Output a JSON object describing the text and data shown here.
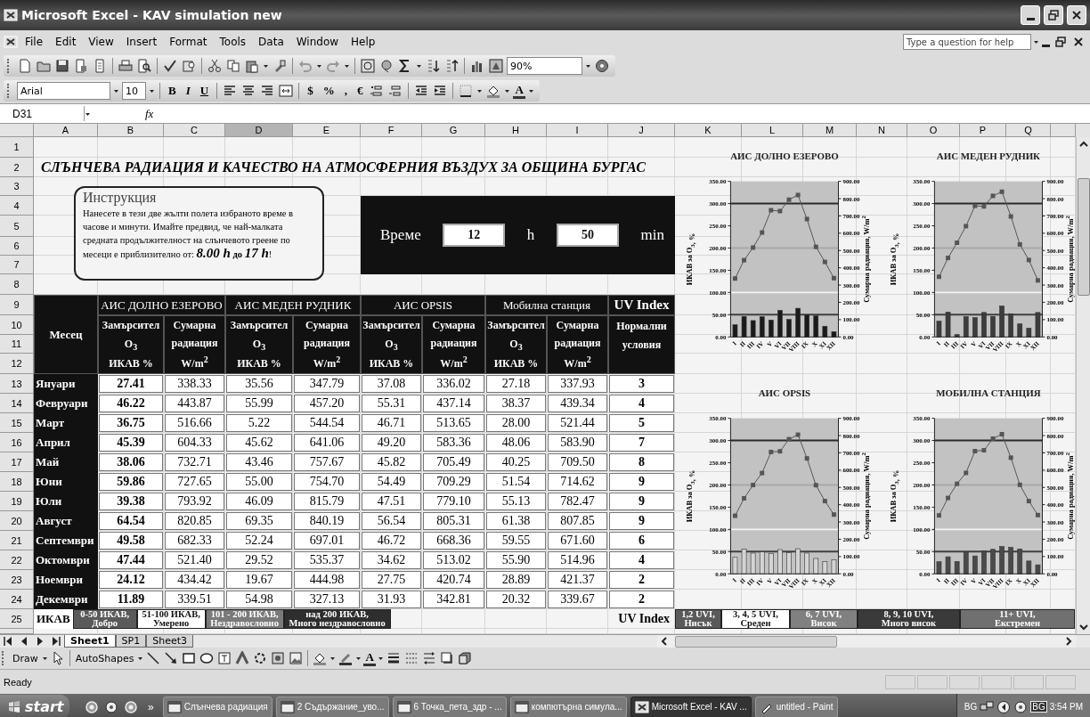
{
  "window": {
    "title": "Microsoft Excel - KAV simulation new"
  },
  "menu": {
    "items": [
      "File",
      "Edit",
      "View",
      "Insert",
      "Format",
      "Tools",
      "Data",
      "Window",
      "Help"
    ],
    "help_placeholder": "Type a question for help"
  },
  "standard_toolbar": {
    "zoom": "90%"
  },
  "formatting_toolbar": {
    "font": "Arial",
    "size": "10",
    "style_buttons": [
      "B",
      "I",
      "U"
    ],
    "number_buttons": [
      "$",
      "%",
      ",",
      "€"
    ],
    "font_color": "A"
  },
  "formula_bar": {
    "name_box": "D31",
    "function_label": "fx"
  },
  "columns": [
    {
      "label": "A",
      "selected": false
    },
    {
      "label": "B",
      "selected": false
    },
    {
      "label": "C",
      "selected": false
    },
    {
      "label": "D",
      "selected": true
    },
    {
      "label": "E",
      "selected": false
    },
    {
      "label": "F",
      "selected": false
    },
    {
      "label": "G",
      "selected": false
    },
    {
      "label": "H",
      "selected": false
    },
    {
      "label": "I",
      "selected": false
    },
    {
      "label": "J",
      "selected": false
    },
    {
      "label": "K",
      "selected": false
    },
    {
      "label": "L",
      "selected": false
    },
    {
      "label": "M",
      "selected": false
    },
    {
      "label": "N",
      "selected": false
    },
    {
      "label": "O",
      "selected": false
    },
    {
      "label": "P",
      "selected": false
    },
    {
      "label": "Q",
      "selected": false
    }
  ],
  "row_numbers": [
    "1",
    "2",
    "3",
    "4",
    "5",
    "6",
    "7",
    "8",
    "9",
    "10",
    "11",
    "12",
    "13",
    "14",
    "15",
    "16",
    "17",
    "18",
    "19",
    "20",
    "21",
    "22",
    "23",
    "24",
    "25"
  ],
  "sheet": {
    "title": "СЛЪНЧЕВА РАДИАЦИЯ И КАЧЕСТВО НА АТМОСФЕРНИЯ ВЪЗДУХ ЗА ОБЩИНА БУРГАС",
    "instruction": {
      "heading": "Инструкция",
      "text": "Нанесете в тези две жълти полета избраното време в часове и минути. Имайте предвид, че най-малката средната продължителност на слънчевото греене по месеци е приблизително от: *8.00 h* **до** *17 h*!"
    },
    "time": {
      "label": "Време",
      "hours": "12",
      "hours_unit": "h",
      "minutes": "50",
      "minutes_unit": "min"
    },
    "table": {
      "month_header": "Месец",
      "stations": [
        {
          "name": "АИС ДОЛНО ЕЗЕРОВО",
          "columns": [
            [
              "Замърсител",
              "O$_{3}$",
              "ИКАВ %"
            ],
            [
              "Сумарна",
              "радиация",
              "W/m$^{2}$"
            ]
          ]
        },
        {
          "name": "АИС МЕДЕН РУДНИК",
          "columns": [
            [
              "Замърсител",
              "O$_{3}$",
              "ИКАВ %"
            ],
            [
              "Сумарна",
              "радиация",
              "W/m$^{2}$"
            ]
          ]
        },
        {
          "name": "АИС OPSIS",
          "columns": [
            [
              "Замърсител",
              "O$_{3}$",
              "ИКАВ %"
            ],
            [
              "Сумарна",
              "радиация",
              "W/m$^{2}$"
            ]
          ]
        },
        {
          "name": "Мобилна станция",
          "columns": [
            [
              "Замърсител",
              "O$_{3}$",
              "ИКАВ %"
            ],
            [
              "Сумарна",
              "радиация",
              "W/m$^{2}$"
            ]
          ]
        }
      ],
      "uv_header": "UV Index",
      "uv_subheader": [
        "Нормални",
        "условия"
      ],
      "rows": [
        {
          "month": "Януари",
          "values": [
            "27.41",
            "338.33",
            "35.56",
            "347.79",
            "37.08",
            "336.02",
            "27.18",
            "337.93",
            "3"
          ]
        },
        {
          "month": "Февруари",
          "values": [
            "46.22",
            "443.87",
            "55.99",
            "457.20",
            "55.31",
            "437.14",
            "38.37",
            "439.34",
            "4"
          ]
        },
        {
          "month": "Март",
          "values": [
            "36.75",
            "516.66",
            "5.22",
            "544.54",
            "46.71",
            "513.65",
            "28.00",
            "521.44",
            "5"
          ]
        },
        {
          "month": "Април",
          "values": [
            "45.39",
            "604.33",
            "45.62",
            "641.06",
            "49.20",
            "583.36",
            "48.06",
            "583.90",
            "7"
          ]
        },
        {
          "month": "Май",
          "values": [
            "38.06",
            "732.71",
            "43.46",
            "757.67",
            "45.82",
            "705.49",
            "40.25",
            "709.50",
            "8"
          ]
        },
        {
          "month": "Юни",
          "values": [
            "59.86",
            "727.65",
            "55.00",
            "754.70",
            "54.49",
            "709.29",
            "51.54",
            "714.62",
            "9"
          ]
        },
        {
          "month": "Юли",
          "values": [
            "39.38",
            "793.92",
            "46.09",
            "815.79",
            "47.51",
            "779.10",
            "55.13",
            "782.47",
            "9"
          ]
        },
        {
          "month": "Август",
          "values": [
            "64.54",
            "820.85",
            "69.35",
            "840.19",
            "56.54",
            "805.31",
            "61.38",
            "807.85",
            "9"
          ]
        },
        {
          "month": "Септември",
          "values": [
            "49.58",
            "682.33",
            "52.24",
            "697.01",
            "46.72",
            "668.36",
            "59.55",
            "671.60",
            "6"
          ]
        },
        {
          "month": "Октомври",
          "values": [
            "47.44",
            "521.40",
            "29.52",
            "535.37",
            "34.62",
            "513.02",
            "55.90",
            "514.96",
            "4"
          ]
        },
        {
          "month": "Ноември",
          "values": [
            "24.12",
            "434.42",
            "19.67",
            "444.98",
            "27.75",
            "420.74",
            "28.89",
            "421.37",
            "2"
          ]
        },
        {
          "month": "Декември",
          "values": [
            "11.89",
            "339.51",
            "54.98",
            "327.13",
            "31.93",
            "342.81",
            "20.32",
            "339.67",
            "2"
          ]
        }
      ]
    },
    "ikav_legend": {
      "label": "ИКАВ",
      "items": [
        {
          "lines": [
            "0-50 ИКАВ,",
            "Добро"
          ],
          "color": "#5a5a5a"
        },
        {
          "lines": [
            "51-100 ИКАВ,",
            "Умерено"
          ],
          "color": "#ffffff"
        },
        {
          "lines": [
            "101 - 200 ИКАВ,",
            "Нездравословно"
          ],
          "color": "#7a7a7a"
        },
        {
          "lines": [
            "над 200 ИКАВ,",
            "Много нездравословно"
          ],
          "color": "#2e2e2e"
        }
      ]
    },
    "uv_legend": {
      "label": "UV Index",
      "items": [
        {
          "lines": [
            "1,2 UVI,",
            "Нисък"
          ],
          "color": "#5a5a5a"
        },
        {
          "lines": [
            "3, 4, 5 UVI,",
            "Среден"
          ],
          "color": "#ffffff"
        },
        {
          "lines": [
            "6, 7 UVI,",
            "Висок"
          ],
          "color": "#808080"
        },
        {
          "lines": [
            "8, 9, 10 UVI,",
            "Много висок"
          ],
          "color": "#3a3a3a"
        },
        {
          "lines": [
            "11+ UVI,",
            "Екстремен"
          ],
          "color": "#707070"
        }
      ]
    },
    "charts": [
      {
        "chart_data": {
          "type": "bar",
          "title": "АИС ДОЛНО ЕЗЕРОВО",
          "ylabel": "ИКАВ за O$_{3}$, %",
          "categories": [
            "I",
            "II",
            "III",
            "IV",
            "V",
            "VI",
            "VII",
            "VIII",
            "IX",
            "X",
            "XI",
            "XII"
          ],
          "ylim": [
            0,
            350
          ],
          "series": [
            {
              "color": "#1a1a1a",
              "values": [
                27.4,
                46.2,
                36.8,
                45.4,
                38.1,
                59.9,
                39.4,
                64.5,
                49.6,
                47.4,
                24.1,
                11.9
              ]
            }
          ],
          "yticks": [
            {
              "value": 0,
              "label": "0.00"
            },
            {
              "value": 50,
              "label": "50.00"
            },
            {
              "value": 100,
              "label": "100.00"
            },
            {
              "value": 150,
              "label": "150.00"
            },
            {
              "value": 200,
              "label": "200.00"
            },
            {
              "value": 250,
              "label": "250.00"
            },
            {
              "value": 300,
              "label": "300.00"
            },
            {
              "value": 350,
              "label": "350.00"
            }
          ],
          "ref_lines": [
            {
              "axis": "y",
              "value": 50,
              "color": "#404040"
            },
            {
              "axis": "y",
              "value": 100,
              "color": "#f4f4f4"
            },
            {
              "axis": "y",
              "value": 200,
              "color": "#a8a8a8"
            },
            {
              "axis": "y",
              "value": 300,
              "color": "#2a2a2a"
            }
          ]
        },
        "radiation_overlay": {
          "chart_data": {
            "type": "line",
            "ylabel": "Сумарна радиация, W/m$^{2}$",
            "categories": [
              null,
              null,
              null,
              null,
              null,
              null,
              null,
              null,
              null,
              null,
              null,
              null
            ],
            "ylim": [
              0,
              900
            ],
            "series": [
              {
                "color": "#555555",
                "marker": "square",
                "values": [
                  338,
                  444,
                  517,
                  604,
                  733,
                  728,
                  794,
                  821,
                  682,
                  521,
                  434,
                  340
                ]
              }
            ],
            "yticks": [
              {
                "value": 0,
                "label": "0.00"
              },
              {
                "value": 100,
                "label": "100.00"
              },
              {
                "value": 200,
                "label": "200.00"
              },
              {
                "value": 300,
                "label": "300.00"
              },
              {
                "value": 400,
                "label": "400.00"
              },
              {
                "value": 500,
                "label": "500.00"
              },
              {
                "value": 600,
                "label": "600.00"
              },
              {
                "value": 700,
                "label": "700.00"
              },
              {
                "value": 800,
                "label": "800.00"
              },
              {
                "value": 900,
                "label": "900.00"
              }
            ]
          }
        }
      },
      {
        "chart_data": {
          "type": "bar",
          "title": "АИС МЕДЕН РУДНИК",
          "ylabel": "ИКАВ за O$_{3}$, %",
          "categories": [
            "I",
            "II",
            "III",
            "IV",
            "V",
            "VI",
            "VII",
            "VIII",
            "IX",
            "X",
            "XI",
            "XII"
          ],
          "ylim": [
            0,
            350
          ],
          "series": [
            {
              "color": "#3c3c3c",
              "values": [
                35.6,
                56.0,
                5.2,
                45.6,
                43.5,
                55.0,
                46.1,
                69.4,
                52.2,
                29.5,
                19.7,
                55.0
              ]
            }
          ],
          "yticks": [
            {
              "value": 0,
              "label": "0.00"
            },
            {
              "value": 50,
              "label": "50.00"
            },
            {
              "value": 100,
              "label": "100.00"
            },
            {
              "value": 150,
              "label": "150.00"
            },
            {
              "value": 200,
              "label": "200.00"
            },
            {
              "value": 250,
              "label": "250.00"
            },
            {
              "value": 300,
              "label": "300.00"
            },
            {
              "value": 350,
              "label": "350.00"
            }
          ],
          "ref_lines": [
            {
              "axis": "y",
              "value": 50,
              "color": "#404040"
            },
            {
              "axis": "y",
              "value": 100,
              "color": "#f4f4f4"
            },
            {
              "axis": "y",
              "value": 200,
              "color": "#a8a8a8"
            },
            {
              "axis": "y",
              "value": 300,
              "color": "#2a2a2a"
            }
          ]
        },
        "radiation_overlay": {
          "chart_data": {
            "type": "line",
            "ylabel": "Сумарна радиация, W/m$^{2}$",
            "categories": [
              null,
              null,
              null,
              null,
              null,
              null,
              null,
              null,
              null,
              null,
              null,
              null
            ],
            "ylim": [
              0,
              900
            ],
            "series": [
              {
                "color": "#555555",
                "marker": "square",
                "values": [
                  348,
                  457,
                  545,
                  641,
                  758,
                  755,
                  816,
                  840,
                  697,
                  535,
                  445,
                  327
                ]
              }
            ],
            "yticks": [
              {
                "value": 0,
                "label": "0.00"
              },
              {
                "value": 100,
                "label": "100.00"
              },
              {
                "value": 200,
                "label": "200.00"
              },
              {
                "value": 300,
                "label": "300.00"
              },
              {
                "value": 400,
                "label": "400.00"
              },
              {
                "value": 500,
                "label": "500.00"
              },
              {
                "value": 600,
                "label": "600.00"
              },
              {
                "value": 700,
                "label": "700.00"
              },
              {
                "value": 800,
                "label": "800.00"
              },
              {
                "value": 900,
                "label": "900.00"
              }
            ]
          }
        }
      },
      {
        "chart_data": {
          "type": "bar",
          "title": "АИС OPSIS",
          "ylabel": "ИКАВ за O$_{3}$, %",
          "categories": [
            "I",
            "II",
            "III",
            "IV",
            "V",
            "VI",
            "VII",
            "VIII",
            "IX",
            "X",
            "XI",
            "XII"
          ],
          "ylim": [
            0,
            350
          ],
          "series": [
            {
              "color": "#d4d4d4",
              "values": [
                37.1,
                55.3,
                46.7,
                49.2,
                45.8,
                54.5,
                47.5,
                56.5,
                46.7,
                34.6,
                27.8,
                31.9
              ]
            }
          ],
          "yticks": [
            {
              "value": 0,
              "label": "0.00"
            },
            {
              "value": 50,
              "label": "50.00"
            },
            {
              "value": 100,
              "label": "100.00"
            },
            {
              "value": 150,
              "label": "150.00"
            },
            {
              "value": 200,
              "label": "200.00"
            },
            {
              "value": 250,
              "label": "250.00"
            },
            {
              "value": 300,
              "label": "300.00"
            },
            {
              "value": 350,
              "label": "350.00"
            }
          ],
          "ref_lines": [
            {
              "axis": "y",
              "value": 50,
              "color": "#404040"
            },
            {
              "axis": "y",
              "value": 100,
              "color": "#f4f4f4"
            },
            {
              "axis": "y",
              "value": 200,
              "color": "#a8a8a8"
            },
            {
              "axis": "y",
              "value": 300,
              "color": "#2a2a2a"
            }
          ]
        },
        "radiation_overlay": {
          "chart_data": {
            "type": "line",
            "ylabel": "Сумарна радиация, W/m$^{2}$",
            "categories": [
              null,
              null,
              null,
              null,
              null,
              null,
              null,
              null,
              null,
              null,
              null,
              null
            ],
            "ylim": [
              0,
              900
            ],
            "series": [
              {
                "color": "#555555",
                "marker": "square",
                "values": [
                  336,
                  437,
                  514,
                  583,
                  705,
                  709,
                  779,
                  805,
                  668,
                  513,
                  421,
                  343
                ]
              }
            ],
            "yticks": [
              {
                "value": 0,
                "label": "0.00"
              },
              {
                "value": 100,
                "label": "100.00"
              },
              {
                "value": 200,
                "label": "200.00"
              },
              {
                "value": 300,
                "label": "300.00"
              },
              {
                "value": 400,
                "label": "400.00"
              },
              {
                "value": 500,
                "label": "500.00"
              },
              {
                "value": 600,
                "label": "600.00"
              },
              {
                "value": 700,
                "label": "700.00"
              },
              {
                "value": 800,
                "label": "800.00"
              },
              {
                "value": 900,
                "label": "900.00"
              }
            ]
          }
        }
      },
      {
        "chart_data": {
          "type": "bar",
          "title": "МОБИЛНА СТАНЦИЯ",
          "ylabel": "ИКАВ за O$_{3}$, %",
          "categories": [
            "I",
            "II",
            "III",
            "IV",
            "V",
            "VI",
            "VII",
            "VIII",
            "IX",
            "X",
            "XI",
            "XII"
          ],
          "ylim": [
            0,
            350
          ],
          "series": [
            {
              "color": "#4a4a4a",
              "values": [
                27.2,
                38.4,
                28.0,
                48.1,
                40.3,
                51.5,
                55.1,
                61.4,
                59.6,
                55.9,
                28.9,
                20.3
              ]
            }
          ],
          "yticks": [
            {
              "value": 0,
              "label": "0.00"
            },
            {
              "value": 50,
              "label": "50.00"
            },
            {
              "value": 100,
              "label": "100.00"
            },
            {
              "value": 150,
              "label": "150.00"
            },
            {
              "value": 200,
              "label": "200.00"
            },
            {
              "value": 250,
              "label": "250.00"
            },
            {
              "value": 300,
              "label": "300.00"
            },
            {
              "value": 350,
              "label": "350.00"
            }
          ],
          "ref_lines": [
            {
              "axis": "y",
              "value": 50,
              "color": "#404040"
            },
            {
              "axis": "y",
              "value": 100,
              "color": "#f4f4f4"
            },
            {
              "axis": "y",
              "value": 200,
              "color": "#a8a8a8"
            },
            {
              "axis": "y",
              "value": 300,
              "color": "#2a2a2a"
            }
          ]
        },
        "radiation_overlay": {
          "chart_data": {
            "type": "line",
            "ylabel": "Сумарна радиация, W/m$^{2}$",
            "categories": [
              null,
              null,
              null,
              null,
              null,
              null,
              null,
              null,
              null,
              null,
              null,
              null
            ],
            "ylim": [
              0,
              900
            ],
            "series": [
              {
                "color": "#555555",
                "marker": "square",
                "values": [
                  338,
                  439,
                  521,
                  584,
                  710,
                  715,
                  782,
                  808,
                  672,
                  515,
                  421,
                  340
                ]
              }
            ],
            "yticks": [
              {
                "value": 0,
                "label": "0.00"
              },
              {
                "value": 100,
                "label": "100.00"
              },
              {
                "value": 200,
                "label": "200.00"
              },
              {
                "value": 300,
                "label": "300.00"
              },
              {
                "value": 400,
                "label": "400.00"
              },
              {
                "value": 500,
                "label": "500.00"
              },
              {
                "value": 600,
                "label": "600.00"
              },
              {
                "value": 700,
                "label": "700.00"
              },
              {
                "value": 800,
                "label": "800.00"
              },
              {
                "value": 900,
                "label": "900.00"
              }
            ]
          }
        }
      }
    ]
  },
  "sheet_tabs": [
    {
      "label": "Sheet1",
      "selected": true
    },
    {
      "label": "SP1",
      "selected": false
    },
    {
      "label": "Sheet3",
      "selected": false
    }
  ],
  "drawing_toolbar": {
    "draw": "Draw",
    "autoshapes": "AutoShapes",
    "font_color": "A"
  },
  "status_bar": {
    "text": "Ready"
  },
  "taskbar": {
    "start": "start",
    "more": "»",
    "tasks": [
      {
        "label": "Слънчева радиация",
        "selected": false
      },
      {
        "label": "2 Съдържание_уво...",
        "selected": false
      },
      {
        "label": "6 Точка_пета_здр - ...",
        "selected": false
      },
      {
        "label": "компютърна симула...",
        "selected": false
      },
      {
        "label": "Microsoft Excel - KAV ...",
        "selected": true
      },
      {
        "label": "untitled - Paint",
        "selected": false
      }
    ],
    "language": "BG",
    "language_indicator": "BG",
    "time": "3:54 PM"
  }
}
